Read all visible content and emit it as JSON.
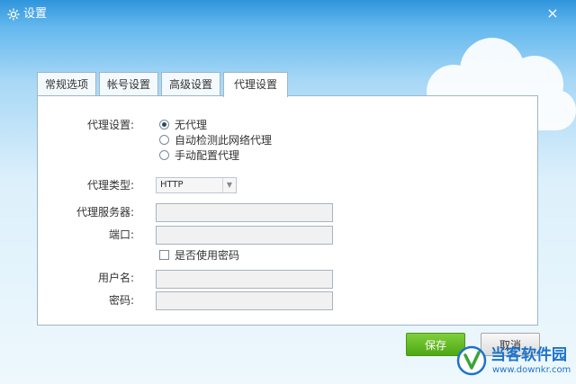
{
  "window": {
    "title": "设置",
    "close_glyph": "×"
  },
  "tabs": [
    {
      "label": "常规选项",
      "active": false
    },
    {
      "label": "帐号设置",
      "active": false
    },
    {
      "label": "高级设置",
      "active": false
    },
    {
      "label": "代理设置",
      "active": true
    }
  ],
  "proxy": {
    "setting_label": "代理设置:",
    "options": [
      {
        "label": "无代理",
        "selected": true
      },
      {
        "label": "自动检测此网络代理",
        "selected": false
      },
      {
        "label": "手动配置代理",
        "selected": false
      }
    ],
    "type_label": "代理类型:",
    "type_value": "HTTP",
    "server_label": "代理服务器:",
    "server_value": "",
    "port_label": "端口:",
    "port_value": "",
    "use_password_label": "是否使用密码",
    "use_password_checked": false,
    "username_label": "用户名:",
    "username_value": "",
    "password_label": "密码:",
    "password_value": ""
  },
  "buttons": {
    "save": "保存",
    "cancel": "取消"
  },
  "watermark": {
    "name": "当客软件园",
    "url": "www.downkr.com"
  },
  "colors": {
    "title_bar": "#2f95dc",
    "save_button": "#5cb521",
    "watermark": "#1e73c8"
  },
  "icons": {
    "title": "gear-icon",
    "close": "close-icon",
    "dropdown": "chevron-down-icon"
  }
}
